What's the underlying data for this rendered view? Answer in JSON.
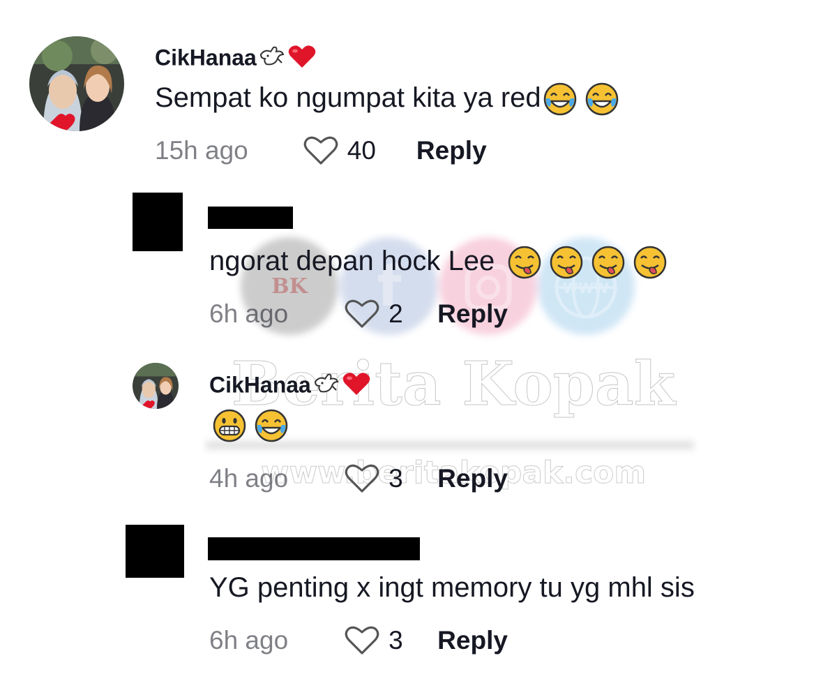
{
  "comments": [
    {
      "username": "CikHanaa",
      "username_emojis": [
        "dove-emoji",
        "heart-emoji"
      ],
      "text": "Sempat ko ngumpat kita ya red",
      "text_emojis": [
        "tears-of-joy-emoji",
        "tears-of-joy-emoji"
      ],
      "time": "15h ago",
      "likes": "40",
      "reply_label": "Reply"
    },
    {
      "username": "",
      "username_redacted": true,
      "text": "ngorat depan hock Lee",
      "text_emojis": [
        "face-savoring-food-emoji",
        "face-savoring-food-emoji",
        "face-savoring-food-emoji",
        "face-savoring-food-emoji"
      ],
      "time": "6h ago",
      "likes": "2",
      "reply_label": "Reply"
    },
    {
      "username": "CikHanaa",
      "username_emojis": [
        "dove-emoji",
        "heart-emoji"
      ],
      "text": "",
      "text_emojis": [
        "grinning-face-emoji",
        "tears-of-joy-emoji"
      ],
      "time": "4h ago",
      "likes": "3",
      "reply_label": "Reply"
    },
    {
      "username": "",
      "username_redacted": true,
      "text": "YG penting x ingt memory tu yg mhl sis",
      "time": "6h ago",
      "likes": "3",
      "reply_label": "Reply"
    }
  ],
  "watermark": {
    "brand": "Berita Kopak",
    "url": "www.beritakopak.com",
    "badge": "BK",
    "icons": [
      "bk-logo-icon",
      "facebook-icon",
      "instagram-icon",
      "website-globe-icon"
    ],
    "colors": {
      "bk": "#2b2b2b",
      "facebook": "#4267b2",
      "instagram": "#e1306c",
      "web": "#2a8fd6"
    }
  },
  "colors": {
    "text": "#161823",
    "muted": "#8a8b91"
  }
}
